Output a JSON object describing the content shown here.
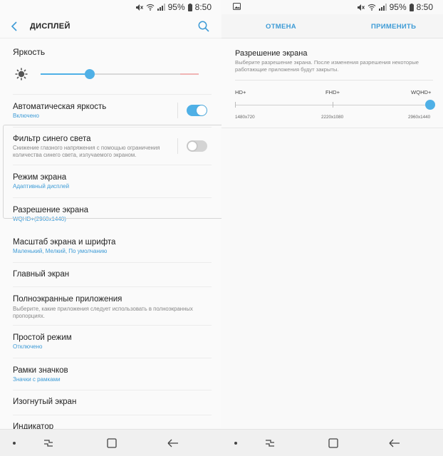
{
  "status": {
    "battery": "95%",
    "time": "8:50"
  },
  "left": {
    "header": {
      "title": "ДИСПЛЕЙ"
    },
    "brightness": {
      "title": "Яркость",
      "level": 0.31
    },
    "items": [
      {
        "title": "Автоматическая яркость",
        "subtitle": "Включено",
        "toggle": true
      },
      {
        "title": "Фильтр синего света",
        "description": "Снижение глазного напряжения с помощью ограничения количества синего света, излучаемого экраном.",
        "toggle": false
      },
      {
        "title": "Режим экрана",
        "subtitle": "Адаптивный дисплей"
      },
      {
        "title": "Разрешение экрана",
        "subtitle": "WQHD+(2960x1440)"
      },
      {
        "title": "Масштаб экрана и шрифта",
        "subtitle": "Маленький, Мелкий, По умолчанию"
      },
      {
        "title": "Главный экран"
      },
      {
        "title": "Полноэкранные приложения",
        "description": "Выберите, какие приложения следует использовать в полноэкранных пропорциях."
      },
      {
        "title": "Простой режим",
        "subtitle": "Отключено"
      },
      {
        "title": "Рамки значков",
        "subtitle": "Значки с рамками"
      },
      {
        "title": "Изогнутый экран"
      },
      {
        "title": "Индикатор"
      }
    ]
  },
  "right": {
    "actions": {
      "cancel": "ОТМЕНА",
      "apply": "ПРИМЕНИТЬ"
    },
    "resolution": {
      "title": "Разрешение экрана",
      "description": "Выберите разрешение экрана. После изменения разрешения некоторые работающие приложения будут закрыты.",
      "options": [
        {
          "label": "HD+",
          "value": "1480x720"
        },
        {
          "label": "FHD+",
          "value": "2220x1080"
        },
        {
          "label": "WQHD+",
          "value": "2960x1440"
        }
      ],
      "selected_index": 2
    }
  },
  "colors": {
    "accent": "#4fb0e6",
    "link": "#3d9bd6"
  }
}
